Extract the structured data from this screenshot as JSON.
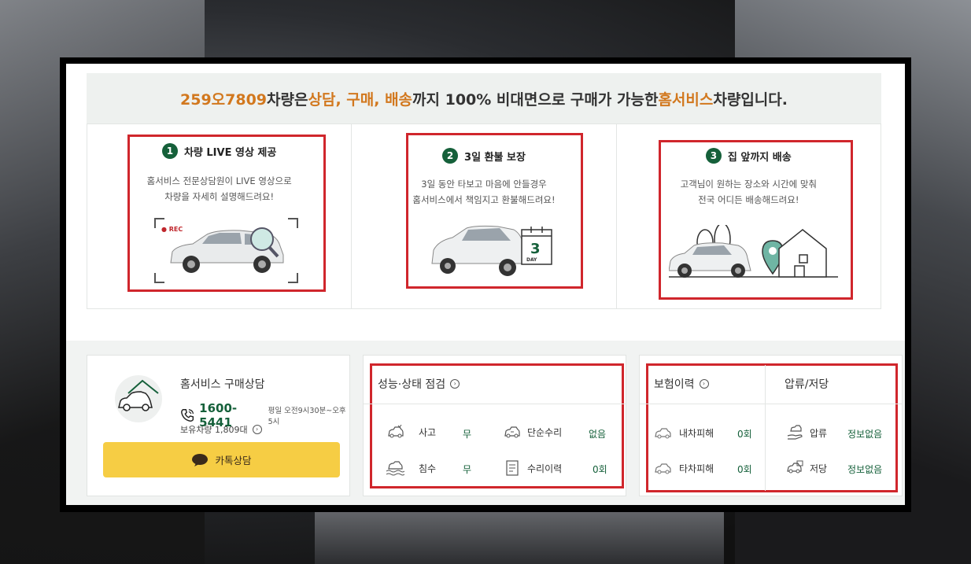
{
  "banner": {
    "plate": "259오7809",
    "t1": " 차량은 ",
    "h1": "상담, 구매, 배송",
    "t2": "까지 100% 비대면으로 구매가 가능한 ",
    "h2": "홈서비스",
    "t3": " 차량입니다."
  },
  "features": [
    {
      "num": "1",
      "title": "차량 LIVE 영상 제공",
      "line1": "홈서비스 전문상담원이 LIVE 영상으로",
      "line2": "차량을 자세히 설명해드려요!",
      "rec": "● REC"
    },
    {
      "num": "2",
      "title": "3일 환불 보장",
      "line1": "3일 동안 타보고 마음에 안들경우",
      "line2": "홈서비스에서 책임지고 환불해드려요!",
      "day_num": "3",
      "day_text": "DAY"
    },
    {
      "num": "3",
      "title": "집 앞까지 배송",
      "line1": "고객님이 원하는 장소와 시간에 맞춰",
      "line2": "전국 어디든 배송해드려요!"
    }
  ],
  "consult": {
    "title": "홈서비스 구매상담",
    "phone": "1600-5441",
    "hours": "평일 오전9시30분~오후5시",
    "stock": "보유차량 1,809대",
    "kakao": "카톡상담"
  },
  "inspection": {
    "title": "성능·상태 점검",
    "items": [
      {
        "label": "사고",
        "value": "무"
      },
      {
        "label": "단순수리",
        "value": "없음"
      },
      {
        "label": "침수",
        "value": "무"
      },
      {
        "label": "수리이력",
        "value": "0회"
      }
    ]
  },
  "insurance": {
    "title": "보험이력",
    "items": [
      {
        "label": "내차피해",
        "value": "0회"
      },
      {
        "label": "타차피해",
        "value": "0회"
      }
    ]
  },
  "seizure": {
    "title": "압류/저당",
    "items": [
      {
        "label": "압류",
        "value": "정보없음"
      },
      {
        "label": "저당",
        "value": "정보없음"
      }
    ]
  },
  "colors": {
    "green": "#15603a",
    "orange": "#d2781e",
    "red": "#d0262c",
    "kakao": "#f6cd44"
  }
}
